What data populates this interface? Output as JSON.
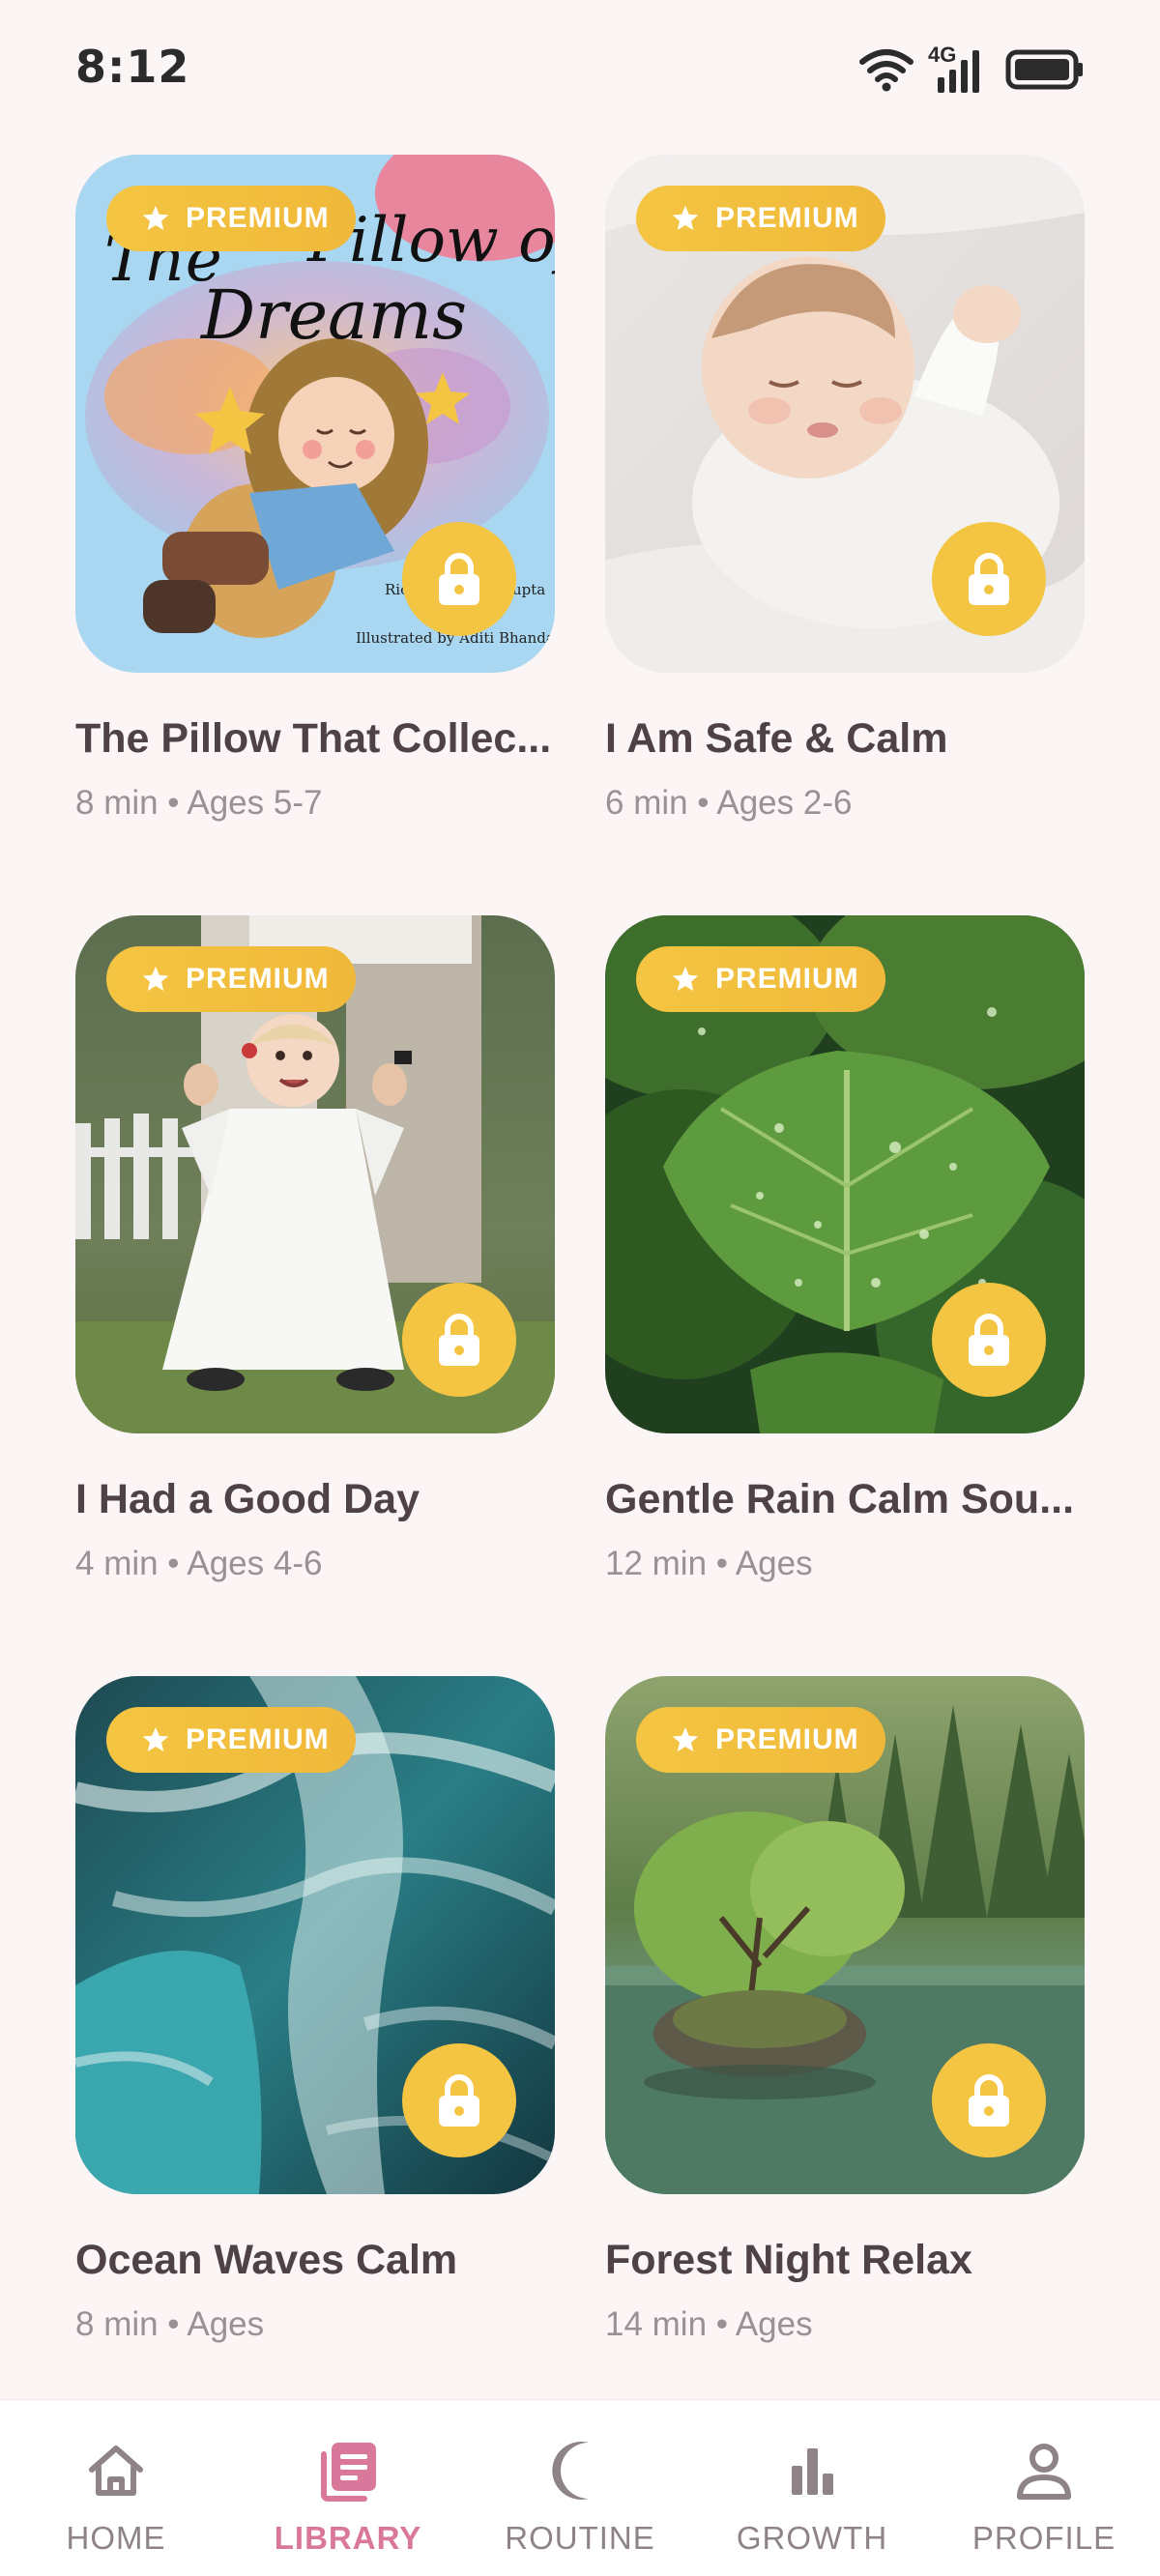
{
  "status_bar": {
    "time": "8:12",
    "network": "4G"
  },
  "badge_label": "PREMIUM",
  "cards": [
    {
      "title": "The Pillow That Collec...",
      "meta": "8 min • Ages 5-7",
      "image": "illustrated-book-cover-girl-sleeping",
      "cover_title": "The Pillow of Dreams",
      "cover_credit_author": "Richa Kishore",
      "cover_credit_author2": "Gupta",
      "cover_credit_illustrator": "Illustrated by Aditi Bhanda"
    },
    {
      "title": "I Am Safe & Calm",
      "meta": "6 min • Ages 2-6",
      "image": "sleeping-baby-photo"
    },
    {
      "title": "I Had a Good Day",
      "meta": "4 min • Ages 4-6",
      "image": "toddler-walking-photo"
    },
    {
      "title": "Gentle Rain Calm Sou...",
      "meta": "12 min • Ages",
      "image": "wet-green-leaves-photo"
    },
    {
      "title": "Ocean Waves Calm",
      "meta": "8 min • Ages",
      "image": "ocean-waves-aerial-photo"
    },
    {
      "title": "Forest Night Relax",
      "meta": "14 min • Ages",
      "image": "forest-lake-tree-photo"
    }
  ],
  "nav": [
    {
      "label": "HOME",
      "icon": "home-icon",
      "active": false
    },
    {
      "label": "LIBRARY",
      "icon": "library-icon",
      "active": true
    },
    {
      "label": "ROUTINE",
      "icon": "moon-icon",
      "active": false
    },
    {
      "label": "GROWTH",
      "icon": "bar-chart-icon",
      "active": false
    },
    {
      "label": "PROFILE",
      "icon": "person-icon",
      "active": false
    }
  ],
  "colors": {
    "background": "#FBF5F5",
    "premium_yellow": "#F4C542",
    "active_pink": "#D9789A",
    "inactive_gray": "#8E8488"
  }
}
